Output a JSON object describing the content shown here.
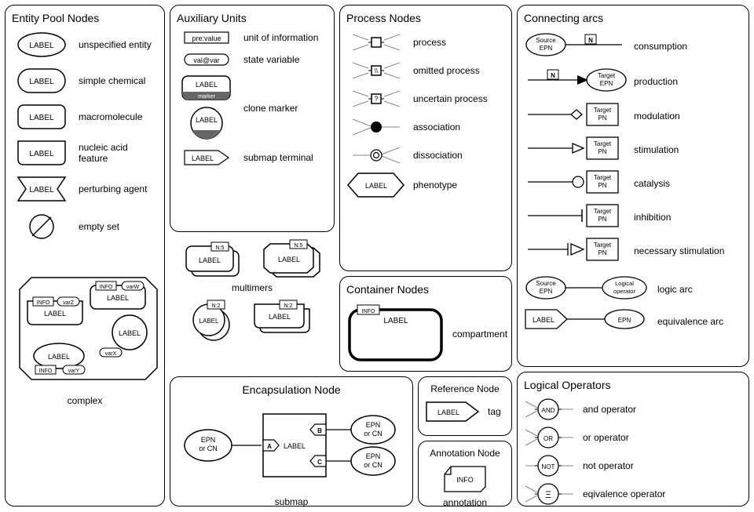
{
  "entityPool": {
    "title": "Entity Pool Nodes",
    "unspecified": "unspecified entity",
    "simpleChemical": "simple chemical",
    "macromolecule": "macromolecule",
    "nucleicAcid": "nucleic acid feature",
    "perturbing": "perturbing agent",
    "emptySet": "empty set",
    "complex": "complex",
    "glyphLabel": "LABEL",
    "info": "INFO",
    "varW": "varW",
    "varX": "varX",
    "varY": "varY",
    "varZ": "varZ"
  },
  "auxiliary": {
    "title": "Auxiliary Units",
    "unitInfo": "unit of information",
    "stateVar": "state variable",
    "cloneMarker": "clone marker",
    "submapTerminal": "submap terminal",
    "preValue": "pre:value",
    "valAtVar": "val@var",
    "marker": "marker",
    "label": "LABEL"
  },
  "multimers": {
    "caption": "multimers",
    "label": "LABEL",
    "n5": "N:5",
    "n2": "N:2"
  },
  "process": {
    "title": "Process Nodes",
    "process": "process",
    "omitted": "omitted process",
    "uncertain": "uncertain process",
    "association": "association",
    "dissociation": "dissociation",
    "phenotype": "phenotype",
    "label": "LABEL",
    "question": "?",
    "slashes": "\\\\"
  },
  "container": {
    "title": "Container Nodes",
    "compartment": "compartment",
    "label": "LABEL",
    "info": "INFO"
  },
  "encapsulation": {
    "title": "Encapsulation Node",
    "submap": "submap",
    "epnOrCn": "EPN\nor CN",
    "label": "LABEL",
    "A": "A",
    "B": "B",
    "C": "C"
  },
  "reference": {
    "title": "Reference Node",
    "tag": "tag",
    "label": "LABEL"
  },
  "annotation": {
    "title": "Annotation Node",
    "annotation": "annotation",
    "info": "INFO"
  },
  "arcs": {
    "title": "Connecting arcs",
    "consumption": "consumption",
    "production": "production",
    "modulation": "modulation",
    "stimulation": "stimulation",
    "catalysis": "catalysis",
    "inhibition": "inhibition",
    "necessaryStim": "necessary stimulation",
    "logicArc": "logic arc",
    "equivalenceArc": "equivalence arc",
    "sourceEpn": "Source\nEPN",
    "targetEpn": "Target\nEPN",
    "targetPn": "Target\nPN",
    "logicalOperator": "Logical\noperator",
    "epn": "EPN",
    "label": "LABEL",
    "N": "N"
  },
  "logical": {
    "title": "Logical Operators",
    "and": "and operator",
    "or": "or operator",
    "not": "not operator",
    "equiv": "eqivalence operator",
    "AND": "AND",
    "OR": "OR",
    "NOT": "NOT",
    "XI": "Ξ"
  }
}
